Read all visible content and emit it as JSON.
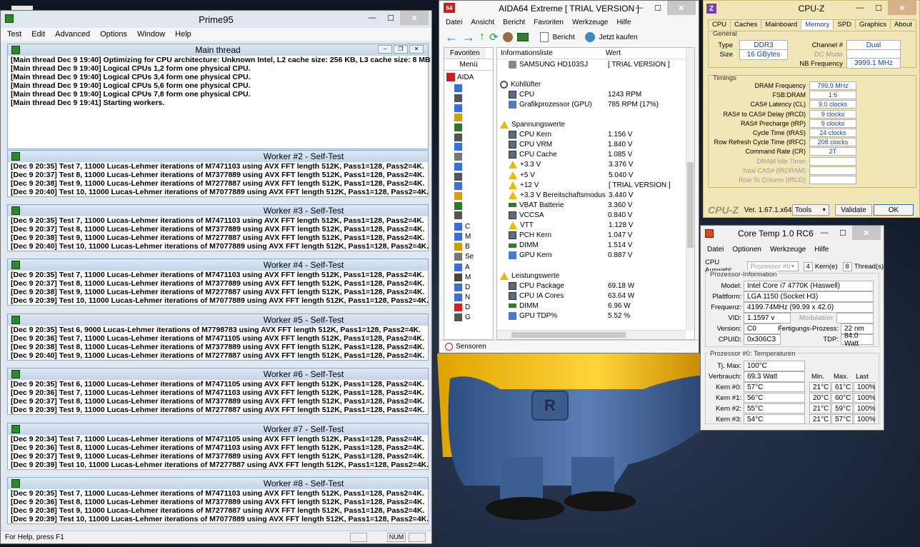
{
  "prime95": {
    "title": "Prime95",
    "menu": [
      "Test",
      "Edit",
      "Advanced",
      "Options",
      "Window",
      "Help"
    ],
    "main_title": "Main thread",
    "main_lines": [
      "[Main thread Dec 9 19:40] Optimizing for CPU architecture: Unknown Intel, L2 cache size: 256 KB, L3 cache size: 8 MB",
      "[Main thread Dec 9 19:40] Logical CPUs 1,2 form one physical CPU.",
      "[Main thread Dec 9 19:40] Logical CPUs 3,4 form one physical CPU.",
      "[Main thread Dec 9 19:40] Logical CPUs 5,6 form one physical CPU.",
      "[Main thread Dec 9 19:40] Logical CPUs 7,8 form one physical CPU.",
      "[Main thread Dec 9 19:41] Starting workers."
    ],
    "workers": [
      {
        "title": "Worker #2 - Self-Test",
        "lines": [
          "[Dec 9 20:35] Test 7, 11000 Lucas-Lehmer iterations of M7471103 using AVX FFT length 512K, Pass1=128, Pass2=4K.",
          "[Dec 9 20:37] Test 8, 11000 Lucas-Lehmer iterations of M7377889 using AVX FFT length 512K, Pass1=128, Pass2=4K.",
          "[Dec 9 20:38] Test 9, 11000 Lucas-Lehmer iterations of M7277887 using AVX FFT length 512K, Pass1=128, Pass2=4K.",
          "[Dec 9 20:40] Test 10, 11000 Lucas-Lehmer iterations of M7077889 using AVX FFT length 512K, Pass1=128, Pass2=4K."
        ]
      },
      {
        "title": "Worker #3 - Self-Test",
        "lines": [
          "[Dec 9 20:35] Test 7, 11000 Lucas-Lehmer iterations of M7471103 using AVX FFT length 512K, Pass1=128, Pass2=4K.",
          "[Dec 9 20:37] Test 8, 11000 Lucas-Lehmer iterations of M7377889 using AVX FFT length 512K, Pass1=128, Pass2=4K.",
          "[Dec 9 20:38] Test 9, 11000 Lucas-Lehmer iterations of M7277887 using AVX FFT length 512K, Pass1=128, Pass2=4K.",
          "[Dec 9 20:40] Test 10, 11000 Lucas-Lehmer iterations of M7077889 using AVX FFT length 512K, Pass1=128, Pass2=4K."
        ]
      },
      {
        "title": "Worker #4 - Self-Test",
        "lines": [
          "[Dec 9 20:35] Test 7, 11000 Lucas-Lehmer iterations of M7471103 using AVX FFT length 512K, Pass1=128, Pass2=4K.",
          "[Dec 9 20:37] Test 8, 11000 Lucas-Lehmer iterations of M7377889 using AVX FFT length 512K, Pass1=128, Pass2=4K.",
          "[Dec 9 20:38] Test 9, 11000 Lucas-Lehmer iterations of M7277887 using AVX FFT length 512K, Pass1=128, Pass2=4K.",
          "[Dec 9 20:39] Test 10, 11000 Lucas-Lehmer iterations of M7077889 using AVX FFT length 512K, Pass1=128, Pass2=4K."
        ]
      },
      {
        "title": "Worker #5 - Self-Test",
        "lines": [
          "[Dec 9 20:35] Test 6, 9000 Lucas-Lehmer iterations of M7798783 using AVX FFT length 512K, Pass1=128, Pass2=4K.",
          "[Dec 9 20:36] Test 7, 11000 Lucas-Lehmer iterations of M7471105 using AVX FFT length 512K, Pass1=128, Pass2=4K.",
          "[Dec 9 20:38] Test 8, 11000 Lucas-Lehmer iterations of M7377889 using AVX FFT length 512K, Pass1=128, Pass2=4K.",
          "[Dec 9 20:40] Test 9, 11000 Lucas-Lehmer iterations of M7277887 using AVX FFT length 512K, Pass1=128, Pass2=4K."
        ]
      },
      {
        "title": "Worker #6 - Self-Test",
        "lines": [
          "[Dec 9 20:35] Test 6, 11000 Lucas-Lehmer iterations of M7471105 using AVX FFT length 512K, Pass1=128, Pass2=4K.",
          "[Dec 9 20:36] Test 7, 11000 Lucas-Lehmer iterations of M7471103 using AVX FFT length 512K, Pass1=128, Pass2=4K.",
          "[Dec 9 20:37] Test 8, 11000 Lucas-Lehmer iterations of M7377889 using AVX FFT length 512K, Pass1=128, Pass2=4K.",
          "[Dec 9 20:39] Test 9, 11000 Lucas-Lehmer iterations of M7277887 using AVX FFT length 512K, Pass1=128, Pass2=4K."
        ]
      },
      {
        "title": "Worker #7 - Self-Test",
        "lines": [
          "[Dec 9 20:34] Test 7, 11000 Lucas-Lehmer iterations of M7471105 using AVX FFT length 512K, Pass1=128, Pass2=4K.",
          "[Dec 9 20:36] Test 8, 11000 Lucas-Lehmer iterations of M7471103 using AVX FFT length 512K, Pass1=128, Pass2=4K.",
          "[Dec 9 20:37] Test 9, 11000 Lucas-Lehmer iterations of M7377889 using AVX FFT length 512K, Pass1=128, Pass2=4K.",
          "[Dec 9 20:39] Test 10, 11000 Lucas-Lehmer iterations of M7277887 using AVX FFT length 512K, Pass1=128, Pass2=4K."
        ]
      },
      {
        "title": "Worker #8 - Self-Test",
        "lines": [
          "[Dec 9 20:35] Test 7, 11000 Lucas-Lehmer iterations of M7471103 using AVX FFT length 512K, Pass1=128, Pass2=4K.",
          "[Dec 9 20:36] Test 8, 11000 Lucas-Lehmer iterations of M7377889 using AVX FFT length 512K, Pass1=128, Pass2=4K.",
          "[Dec 9 20:38] Test 9, 11000 Lucas-Lehmer iterations of M7277887 using AVX FFT length 512K, Pass1=128, Pass2=4K.",
          "[Dec 9 20:39] Test 10, 11000 Lucas-Lehmer iterations of M7077889 using AVX FFT length 512K, Pass1=128, Pass2=4K."
        ]
      }
    ],
    "status_help": "For Help, press F1",
    "status_num": "NUM"
  },
  "aida": {
    "title": "AIDA64 Extreme  [ TRIAL VERSION ]",
    "icon_label": "64",
    "menu": [
      "Datei",
      "Ansicht",
      "Bericht",
      "Favoriten",
      "Werkzeuge",
      "Hilfe"
    ],
    "toolbar_bericht": "Bericht",
    "toolbar_kaufen": "Jetzt kaufen",
    "tab_favoriten": "Favoriten",
    "tab_menu": "Menü",
    "tree_root": "AIDA",
    "tree_items": [
      "C",
      "M",
      "B",
      "Se",
      "A",
      "M",
      "D",
      "N",
      "D",
      "G"
    ],
    "col_info": "Informationsliste",
    "col_wert": "Wert",
    "rows": [
      {
        "type": "item",
        "icon": "disk",
        "name": "SAMSUNG HD103SJ",
        "value": "[ TRIAL VERSION ]"
      },
      {
        "type": "blank"
      },
      {
        "type": "group",
        "icon": "fan",
        "name": "Kühllüfter"
      },
      {
        "type": "item",
        "icon": "chip",
        "name": "CPU",
        "value": "1243 RPM"
      },
      {
        "type": "item",
        "icon": "gpu",
        "name": "Grafikprozessor (GPU)",
        "value": "785 RPM  (17%)"
      },
      {
        "type": "blank"
      },
      {
        "type": "group",
        "icon": "warn",
        "name": "Spannungswerte"
      },
      {
        "type": "item",
        "icon": "chip",
        "name": "CPU Kern",
        "value": "1.156 V"
      },
      {
        "type": "item",
        "icon": "chip",
        "name": "CPU VRM",
        "value": "1.840 V"
      },
      {
        "type": "item",
        "icon": "chip",
        "name": "CPU Cache",
        "value": "1.085 V"
      },
      {
        "type": "item",
        "icon": "warn",
        "name": "+3.3 V",
        "value": "3.376 V"
      },
      {
        "type": "item",
        "icon": "warn",
        "name": "+5 V",
        "value": "5.040 V"
      },
      {
        "type": "item",
        "icon": "warn",
        "name": "+12 V",
        "value": "[ TRIAL VERSION ]"
      },
      {
        "type": "item",
        "icon": "warn",
        "name": "+3.3 V Bereitschaftsmodus",
        "value": "3.440 V"
      },
      {
        "type": "item",
        "icon": "ram",
        "name": "VBAT Batterie",
        "value": "3.360 V"
      },
      {
        "type": "item",
        "icon": "chip",
        "name": "VCCSA",
        "value": "0.840 V"
      },
      {
        "type": "item",
        "icon": "warn",
        "name": "VTT",
        "value": "1.128 V"
      },
      {
        "type": "item",
        "icon": "chip",
        "name": "PCH Kern",
        "value": "1.047 V"
      },
      {
        "type": "item",
        "icon": "ram",
        "name": "DIMM",
        "value": "1.514 V"
      },
      {
        "type": "item",
        "icon": "gpu",
        "name": "GPU Kern",
        "value": "0.887 V"
      },
      {
        "type": "blank"
      },
      {
        "type": "group",
        "icon": "warn",
        "name": "Leistungswerte"
      },
      {
        "type": "item",
        "icon": "chip",
        "name": "CPU Package",
        "value": "69.18 W"
      },
      {
        "type": "item",
        "icon": "chip",
        "name": "CPU IA Cores",
        "value": "63.64 W"
      },
      {
        "type": "item",
        "icon": "ram",
        "name": "DIMM",
        "value": "6.96 W"
      },
      {
        "type": "item",
        "icon": "gpu",
        "name": "GPU TDP%",
        "value": "5.52 %"
      }
    ],
    "status": "Sensoren"
  },
  "cpuz": {
    "title": "CPU-Z",
    "tabs": [
      "CPU",
      "Caches",
      "Mainboard",
      "Memory",
      "SPD",
      "Graphics",
      "About"
    ],
    "active_tab": "Memory",
    "general_label": "General",
    "type_label": "Type",
    "type_value": "DDR3",
    "size_label": "Size",
    "size_value": "16 GBytes",
    "channel_label": "Channel #",
    "channel_value": "Dual",
    "dcmode_label": "DC Mode",
    "dcmode_value": "",
    "nbfreq_label": "NB Frequency",
    "nbfreq_value": "3999.1 MHz",
    "timings_label": "Timings",
    "timings": [
      {
        "label": "DRAM Frequency",
        "value": "799.9 MHz",
        "dim": false
      },
      {
        "label": "FSB:DRAM",
        "value": "1:6",
        "dim": false
      },
      {
        "label": "CAS# Latency (CL)",
        "value": "9.0 clocks",
        "dim": false
      },
      {
        "label": "RAS# to CAS# Delay (tRCD)",
        "value": "9 clocks",
        "dim": false
      },
      {
        "label": "RAS# Precharge (tRP)",
        "value": "9 clocks",
        "dim": false
      },
      {
        "label": "Cycle Time (tRAS)",
        "value": "24 clocks",
        "dim": false
      },
      {
        "label": "Row Refresh Cycle Time (tRFC)",
        "value": "208 clocks",
        "dim": false
      },
      {
        "label": "Command Rate (CR)",
        "value": "2T",
        "dim": false
      },
      {
        "label": "DRAM Idle Timer",
        "value": "",
        "dim": true
      },
      {
        "label": "Total CAS# (tRDRAM)",
        "value": "",
        "dim": true
      },
      {
        "label": "Row To Column (tRCD)",
        "value": "",
        "dim": true
      }
    ],
    "brand": "CPU-Z",
    "version": "Ver. 1.67.1.x64",
    "tools_label": "Tools",
    "validate_label": "Validate",
    "ok_label": "OK"
  },
  "coretemp": {
    "title": "Core Temp 1.0 RC6",
    "menu": [
      "Datei",
      "Optionen",
      "Werkzeuge",
      "Hilfe"
    ],
    "cpu_select_label": "CPU Auswahl:",
    "cpu_select_value": "Prozessor #0",
    "cores_value": "4",
    "cores_label": "Kern(e)",
    "threads_value": "8",
    "threads_label": "Thread(s)",
    "info_section": "Prozessor-Information",
    "model_label": "Model:",
    "model_value": "Intel Core i7 4770K (Haswell)",
    "platform_label": "Plattform:",
    "platform_value": "LGA 1150 (Socket H3)",
    "freq_label": "Frequenz:",
    "freq_value": "4199.74MHz (99.99 x 42.0)",
    "vid_label": "VID:",
    "vid_value": "1.1597 v",
    "modulation_label": "Modulation:",
    "modulation_value": "",
    "version_label": "Version:",
    "version_value": "C0",
    "lithography_label": "Fertigungs-Prozess:",
    "lithography_value": "22 nm",
    "cpuid_label": "CPUID:",
    "cpuid_value": "0x306C3",
    "tdp_label": "TDP:",
    "tdp_value": "84.0 Watt",
    "temp_section": "Prozessor #0: Temperaturen",
    "tjmax_label": "Tj. Max:",
    "tjmax_value": "100°C",
    "power_label": "Verbrauch:",
    "power_value": "69.3 Watt",
    "col_min": "Min.",
    "col_max": "Max.",
    "col_last": "Last",
    "cores": [
      {
        "label": "Kern #0:",
        "temp": "57°C",
        "min": "21°C",
        "max": "61°C",
        "load": "100%"
      },
      {
        "label": "Kern #1:",
        "temp": "56°C",
        "min": "20°C",
        "max": "60°C",
        "load": "100%"
      },
      {
        "label": "Kern #2:",
        "temp": "55°C",
        "min": "21°C",
        "max": "59°C",
        "load": "100%"
      },
      {
        "label": "Kern #3:",
        "temp": "54°C",
        "min": "21°C",
        "max": "57°C",
        "load": "100%"
      }
    ]
  }
}
